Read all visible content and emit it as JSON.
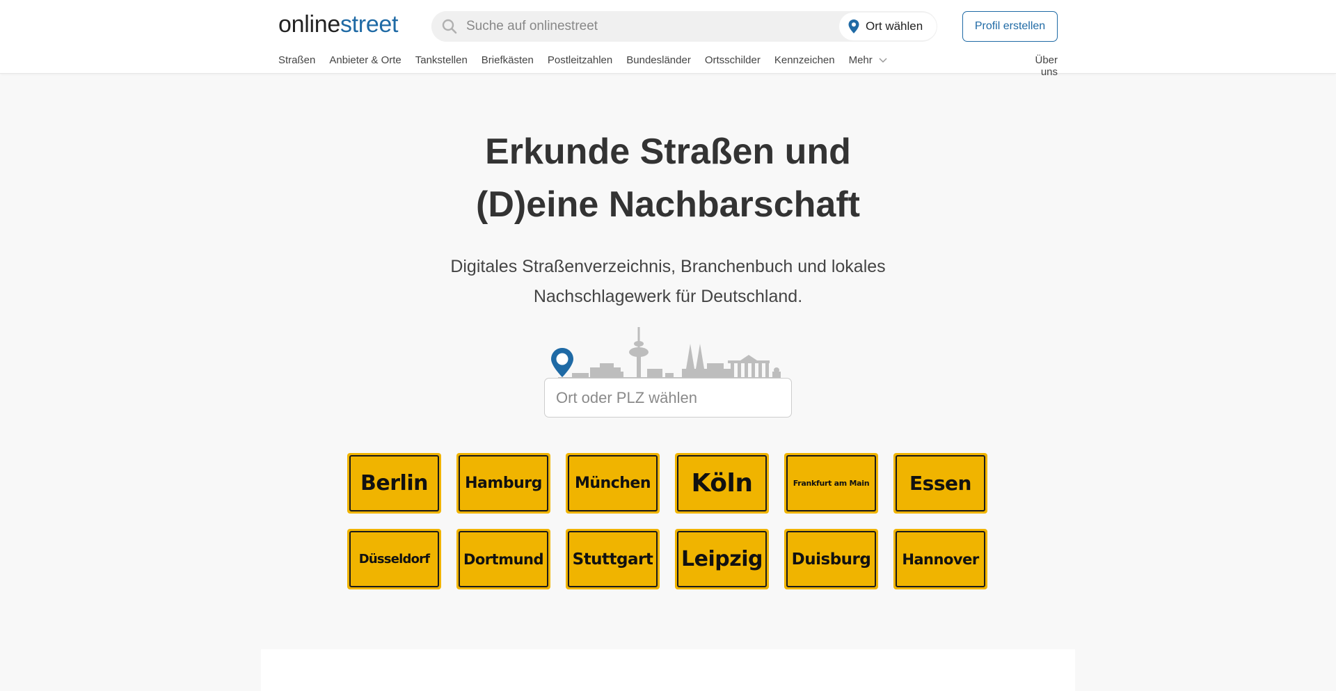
{
  "header": {
    "logo_part1": "online",
    "logo_part2": "street",
    "search_placeholder": "Suche auf onlinestreet",
    "location_button": "Ort wählen",
    "profile_button": "Profil erstellen"
  },
  "nav": {
    "items": [
      "Straßen",
      "Anbieter & Orte",
      "Tankstellen",
      "Briefkästen",
      "Postleitzahlen",
      "Bundesländer",
      "Ortsschilder",
      "Kennzeichen",
      "Mehr"
    ],
    "about": "Über uns"
  },
  "hero": {
    "title_line1": "Erkunde Straßen und",
    "title_line2": "(D)eine Nachbarschaft",
    "subtitle_line1": "Digitales Straßenverzeichnis, Branchenbuch und lokales",
    "subtitle_line2": "Nachschlagewerk für Deutschland.",
    "location_placeholder": "Ort oder PLZ wählen"
  },
  "cities": [
    "Berlin",
    "Hamburg",
    "München",
    "Köln",
    "Frankfurt am Main",
    "Essen",
    "Düsseldorf",
    "Dortmund",
    "Stuttgart",
    "Leipzig",
    "Duisburg",
    "Hannover"
  ],
  "colors": {
    "accent": "#1f6aa5",
    "sign_yellow": "#f0b400",
    "background": "#f8f8f8"
  },
  "icons": {
    "search": "search-icon",
    "location": "map-pin-icon",
    "more": "chevron-down-icon",
    "skyline": "city-skyline-icon"
  }
}
